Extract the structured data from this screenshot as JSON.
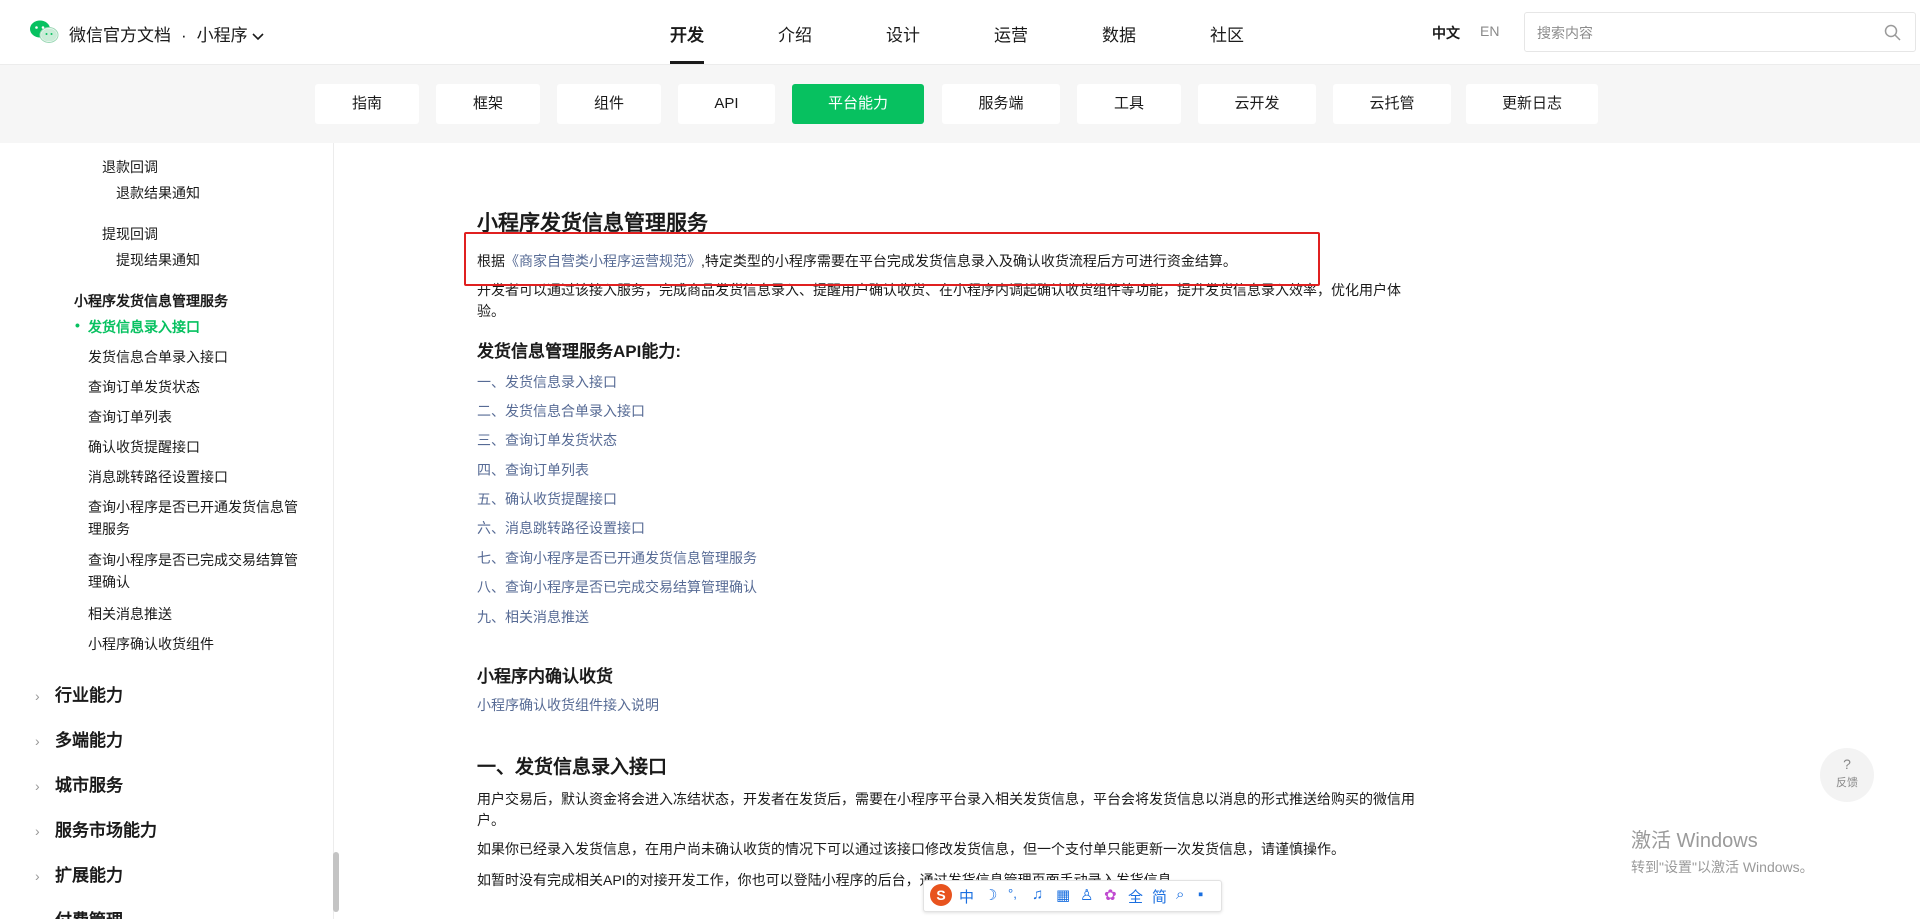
{
  "header": {
    "brand_title": "微信官方文档",
    "brand_sep": "·",
    "brand_product": "小程序",
    "nav": [
      "开发",
      "介绍",
      "设计",
      "运营",
      "数据",
      "社区"
    ],
    "lang_zh": "中文",
    "lang_en": "EN",
    "search_placeholder": "搜索内容"
  },
  "subnav": {
    "tabs": [
      "指南",
      "框架",
      "组件",
      "API",
      "平台能力",
      "服务端",
      "工具",
      "云开发",
      "云托管",
      "更新日志"
    ],
    "active": "平台能力"
  },
  "sidebar": {
    "items": [
      "退款回调",
      "退款结果通知",
      "提现回调",
      "提现结果通知",
      "小程序发货信息管理服务",
      "发货信息录入接口",
      "发货信息合单录入接口",
      "查询订单发货状态",
      "查询订单列表",
      "确认收货提醒接口",
      "消息跳转路径设置接口",
      "查询小程序是否已开通发货信息管理服务",
      "查询小程序是否已完成交易结算管理确认",
      "相关消息推送",
      "小程序确认收货组件"
    ],
    "groups": [
      "行业能力",
      "多端能力",
      "城市服务",
      "服务市场能力",
      "扩展能力",
      "付费管理"
    ]
  },
  "content": {
    "title": "小程序发货信息管理服务",
    "p1_prefix": "根据",
    "p1_link": "《商家自营类小程序运营规范》",
    "p1_suffix": ",特定类型的小程序需要在平台完成发货信息录入及确认收货流程后方可进行资金结算。",
    "p2": "开发者可以通过该接入服务，完成商品发货信息录入、提醒用户确认收货、在小程序内调起确认收货组件等功能，提升发货信息录入效率，优化用户体验。",
    "api_heading": "发货信息管理服务API能力:",
    "api_links": [
      "一、发货信息录入接口",
      "二、发货信息合单录入接口",
      "三、查询订单发货状态",
      "四、查询订单列表",
      "五、确认收货提醒接口",
      "六、消息跳转路径设置接口",
      "七、查询小程序是否已开通发货信息管理服务",
      "八、查询小程序是否已完成交易结算管理确认",
      "九、相关消息推送"
    ],
    "confirm_heading": "小程序内确认收货",
    "confirm_link": "小程序确认收货组件接入说明",
    "section1_title": "一、发货信息录入接口",
    "s1_p1": "用户交易后，默认资金将会进入冻结状态，开发者在发货后，需要在小程序平台录入相关发货信息，平台会将发货信息以消息的形式推送给购买的微信用户。",
    "s1_p2": "如果你已经录入发货信息，在用户尚未确认收货的情况下可以通过该接口修改发货信息，但一个支付单只能更新一次发货信息，请谨慎操作。",
    "s1_p3": "如暂时没有完成相关API的对接开发工作，你也可以登陆小程序的后台，通过发货信息管理页面手动录入发货信息。"
  },
  "feedback": {
    "icon": "?",
    "label": "反馈"
  },
  "watermark": {
    "line1": "激活 Windows",
    "line2": "转到\"设置\"以激活 Windows。"
  },
  "ime": {
    "logo": "S",
    "mode": "中",
    "full": "全",
    "simp": "简"
  },
  "colors": {
    "accent": "#07c160",
    "link": "#576b95",
    "highlight": "#e02020"
  }
}
